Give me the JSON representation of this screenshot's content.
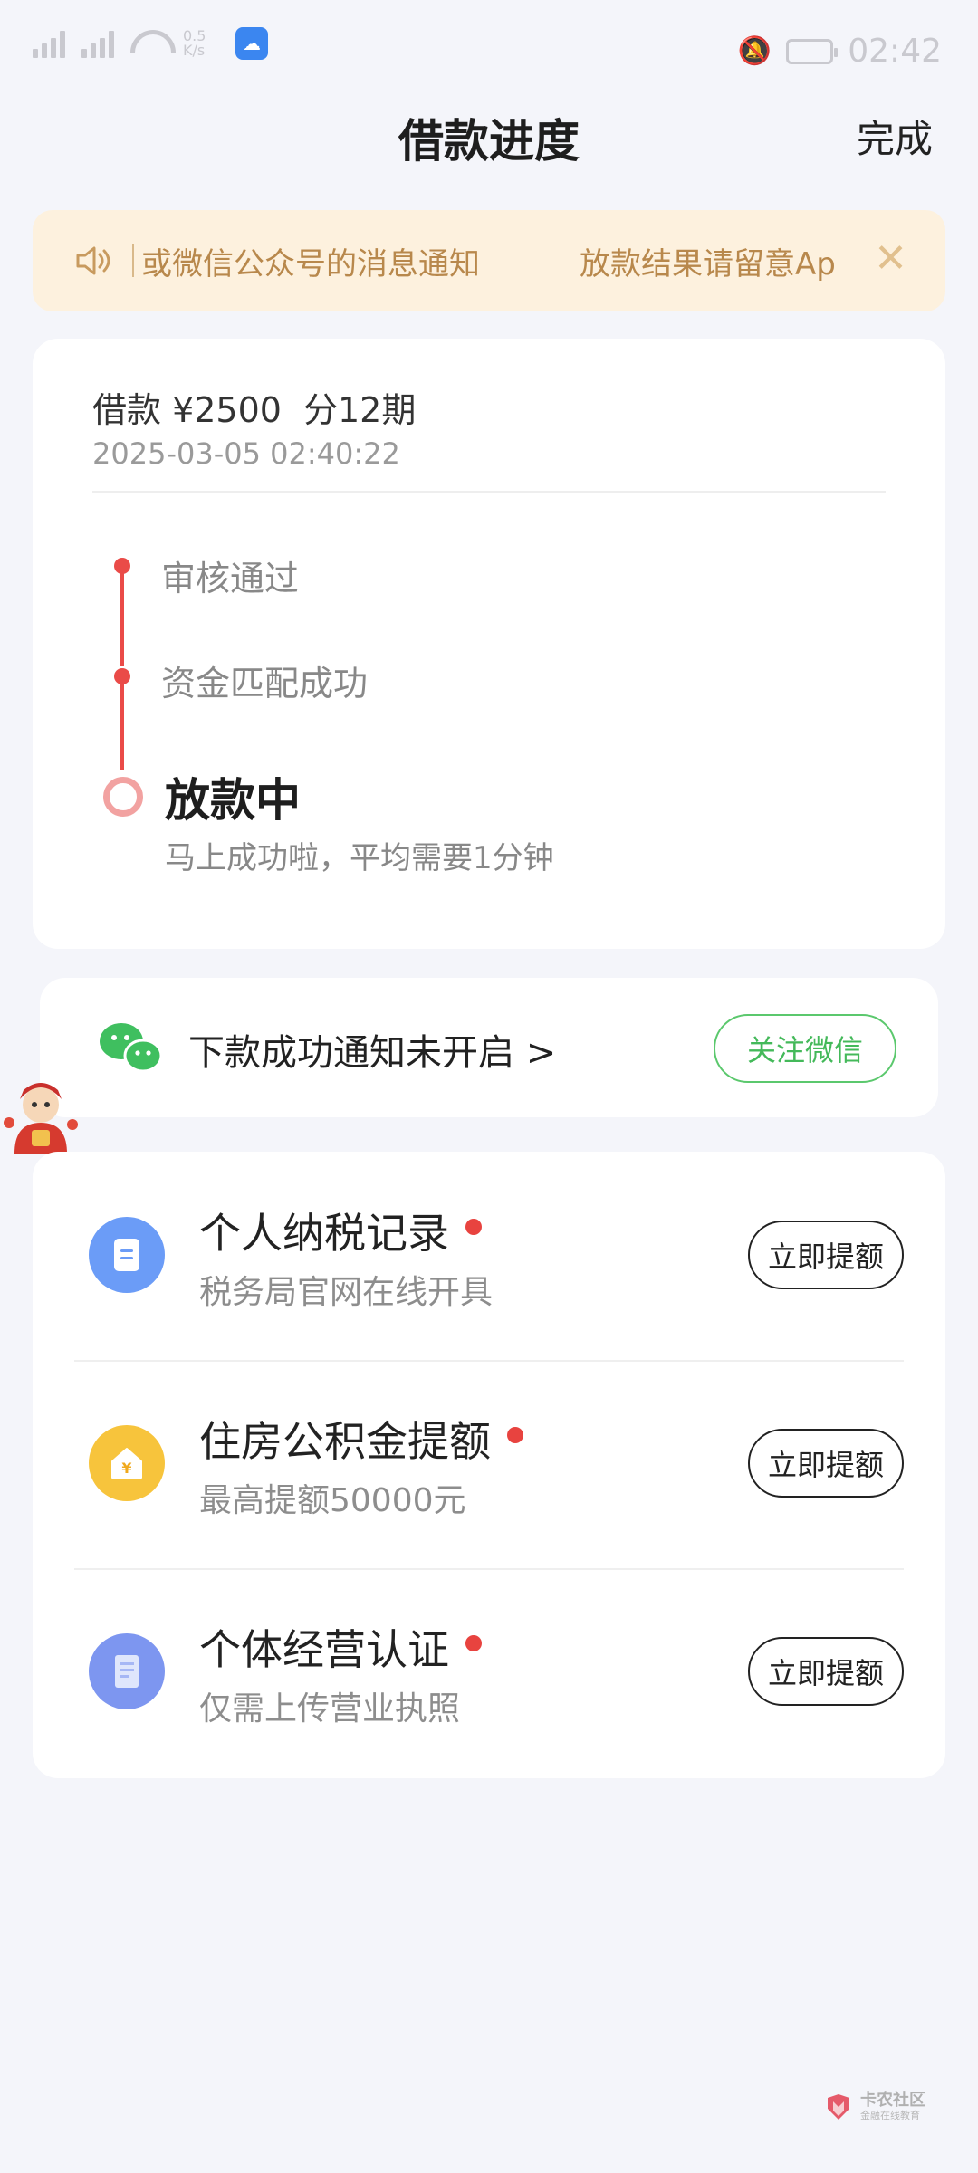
{
  "status_bar": {
    "net_speed": "0.5 K/s",
    "time": "02:42",
    "icons": [
      "signal-icon",
      "signal-icon",
      "wifi-icon",
      "weather-app-icon",
      "mute-icon",
      "battery-icon"
    ]
  },
  "header": {
    "title": "借款进度",
    "done_label": "完成"
  },
  "notice": {
    "icon": "speaker-icon",
    "text_part1": "或微信公众号的消息通知",
    "text_part2": "放款结果请留意Ap",
    "close_icon": "close-icon"
  },
  "loan": {
    "amount_label": "借款 ¥2500",
    "term_label": "分12期",
    "time": "2025-03-05 02:40:22",
    "steps": [
      {
        "label": "审核通过",
        "state": "done"
      },
      {
        "label": "资金匹配成功",
        "state": "done"
      },
      {
        "label": "放款中",
        "state": "current",
        "sub": "马上成功啦，平均需要1分钟"
      }
    ],
    "accent_color": "#ea4b48"
  },
  "wechat": {
    "icon": "wechat-icon",
    "text": "下款成功通知未开启 >",
    "button_label": "关注微信",
    "accent_color": "#44b95a"
  },
  "quota_items": [
    {
      "icon": "document-icon",
      "title": "个人纳税记录",
      "sub": "税务局官网在线开具",
      "button": "立即提额",
      "icon_color": "#6b9cf7"
    },
    {
      "icon": "house-yuan-icon",
      "title": "住房公积金提额",
      "sub": "最高提额50000元",
      "button": "立即提额",
      "icon_color": "#f7c43c"
    },
    {
      "icon": "paper-icon",
      "title": "个体经营认证",
      "sub": "仅需上传营业执照",
      "button": "立即提额",
      "icon_color": "#7d96f0"
    }
  ],
  "watermark": {
    "main": "卡农社区",
    "sub": "金融在线教育"
  }
}
